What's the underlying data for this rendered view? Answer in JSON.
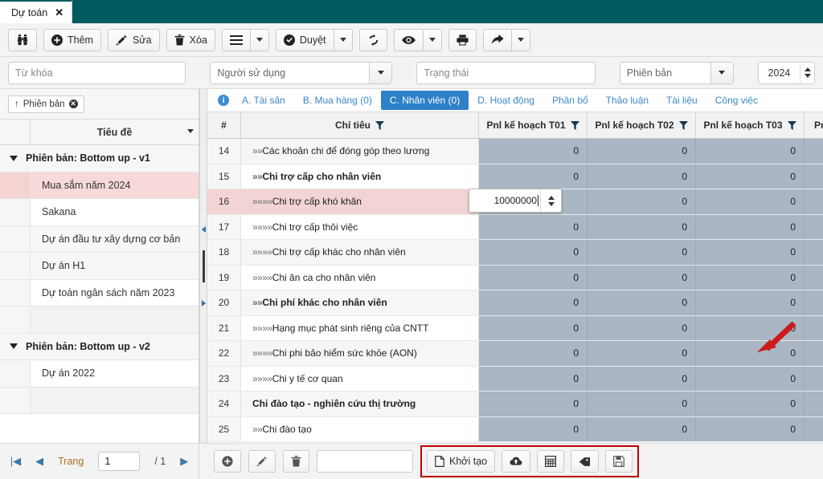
{
  "window": {
    "tab_title": "Dự toán",
    "close_label": "✕"
  },
  "toolbar": {
    "search_icon": "binoculars-icon",
    "add_label": "Thêm",
    "edit_label": "Sửa",
    "delete_label": "Xóa",
    "menu_icon": "hamburger-icon",
    "approve_label": "Duyệt",
    "refresh_icon": "refresh-icon",
    "view_icon": "eye-icon",
    "print_icon": "printer-icon",
    "share_icon": "share-arrow-icon"
  },
  "filters": {
    "keyword_placeholder": "Từ khóa",
    "user_placeholder": "Người sử dụng",
    "status_placeholder": "Trạng thái",
    "version_placeholder": "Phiên bản",
    "year_value": "2024"
  },
  "left_panel": {
    "group_chip": "Phiên bản",
    "group_chip_arrow": "↑",
    "column_header": "Tiêu đề",
    "rows": [
      {
        "type": "group",
        "label": "Phiên bản: Bottom up - v1"
      },
      {
        "type": "item",
        "label": "Mua sắm năm 2024",
        "selected": true
      },
      {
        "type": "item",
        "label": "Sakana",
        "selected": false
      },
      {
        "type": "item",
        "label": "Dự án đầu tư xây dựng cơ bản",
        "selected": false
      },
      {
        "type": "item",
        "label": "Dự án H1",
        "selected": false
      },
      {
        "type": "item",
        "label": "Dự toán ngân sách năm 2023",
        "selected": false
      },
      {
        "type": "blank",
        "label": ""
      },
      {
        "type": "group",
        "label": "Phiên bản: Bottom up - v2"
      },
      {
        "type": "item",
        "label": "Dự án 2022",
        "selected": false
      },
      {
        "type": "blank",
        "label": ""
      }
    ]
  },
  "sub_tabs": {
    "info_icon": "info-icon",
    "items": [
      {
        "label": "A. Tài sản",
        "active": false
      },
      {
        "label": "B. Mua hàng (0)",
        "active": false
      },
      {
        "label": "C. Nhân viên (0)",
        "active": true
      },
      {
        "label": "D. Hoạt động",
        "active": false
      },
      {
        "label": "Phân bổ",
        "active": false
      },
      {
        "label": "Thảo luận",
        "active": false
      },
      {
        "label": "Tài liệu",
        "active": false
      },
      {
        "label": "Công việc",
        "active": false
      }
    ]
  },
  "grid": {
    "columns": [
      {
        "key": "num",
        "label": "#",
        "filter": false
      },
      {
        "key": "name",
        "label": "Chỉ tiêu",
        "filter": true
      },
      {
        "key": "t01",
        "label": "Pnl kế hoạch T01",
        "filter": true
      },
      {
        "key": "t02",
        "label": "Pnl kế hoạch T02",
        "filter": true
      },
      {
        "key": "t03",
        "label": "Pnl kế hoạch T03",
        "filter": true
      },
      {
        "key": "t04",
        "label": "Pnl kế",
        "filter": false
      }
    ],
    "rows": [
      {
        "num": "14",
        "prefix": "»»",
        "name": "Các khoản chi để đóng góp theo lương",
        "bold": false,
        "selected": false,
        "t01": "0",
        "t02": "0",
        "t03": "0"
      },
      {
        "num": "15",
        "prefix": "»»",
        "name": "Chi trợ cấp cho nhân viên",
        "bold": true,
        "selected": false,
        "t01": "0",
        "t02": "0",
        "t03": "0"
      },
      {
        "num": "16",
        "prefix": "»»»»",
        "name": "Chi trợ cấp khó khăn",
        "bold": false,
        "selected": true,
        "t01": "",
        "t02": "0",
        "t03": "0"
      },
      {
        "num": "17",
        "prefix": "»»»»",
        "name": "Chi trợ cấp thôi việc",
        "bold": false,
        "selected": false,
        "t01": "0",
        "t02": "0",
        "t03": "0"
      },
      {
        "num": "18",
        "prefix": "»»»»",
        "name": "Chi trợ cấp khác cho nhân viên",
        "bold": false,
        "selected": false,
        "t01": "0",
        "t02": "0",
        "t03": "0"
      },
      {
        "num": "19",
        "prefix": "»»»»",
        "name": "Chi ăn ca cho nhân viên",
        "bold": false,
        "selected": false,
        "t01": "0",
        "t02": "0",
        "t03": "0"
      },
      {
        "num": "20",
        "prefix": "»»",
        "name": "Chi phí khác cho nhân viên",
        "bold": true,
        "selected": false,
        "t01": "0",
        "t02": "0",
        "t03": "0"
      },
      {
        "num": "21",
        "prefix": "»»»»",
        "name": "Hạng mục phát sinh riêng của CNTT",
        "bold": false,
        "selected": false,
        "t01": "0",
        "t02": "0",
        "t03": "0"
      },
      {
        "num": "22",
        "prefix": "»»»»",
        "name": "Chi phi bảo hiểm sức khỏe (AON)",
        "bold": false,
        "selected": false,
        "t01": "0",
        "t02": "0",
        "t03": "0"
      },
      {
        "num": "23",
        "prefix": "»»»»",
        "name": "Chi y tế cơ quan",
        "bold": false,
        "selected": false,
        "t01": "0",
        "t02": "0",
        "t03": "0"
      },
      {
        "num": "24",
        "prefix": "",
        "name": "Chi đào tạo - nghiên cứu thị trường",
        "bold": true,
        "selected": false,
        "t01": "0",
        "t02": "0",
        "t03": "0"
      },
      {
        "num": "25",
        "prefix": "»»",
        "name": "Chi đào tạo",
        "bold": false,
        "selected": false,
        "t01": "0",
        "t02": "0",
        "t03": "0"
      }
    ],
    "cell_editor": {
      "value": "10000000",
      "spinner_icon": "spinner-up-down-icon"
    },
    "annotation": {
      "arrow_icon": "red-arrow-icon",
      "color": "#cc1a1a"
    }
  },
  "pager": {
    "first_icon": "first-page-icon",
    "prev_icon": "prev-page-icon",
    "page_label": "Trang",
    "page_value": "1",
    "total_label": "/ 1",
    "next_icon": "next-page-icon"
  },
  "bottom_tools": {
    "add_icon": "add-circle-icon",
    "edit_icon": "pencil-icon",
    "delete_icon": "trash-icon",
    "text_value": "",
    "create_label": "Khởi tạo",
    "create_icon": "file-icon",
    "upload_icon": "cloud-upload-icon",
    "table_icon": "grid-table-icon",
    "tag_icon": "tag-icon",
    "save_icon": "floppy-save-icon",
    "highlight_color": "#c00000"
  },
  "colors": {
    "title_bar": "#005a5f",
    "active_tab": "#2e80c8",
    "data_cell": "#aab6c4",
    "selected_row": "#f3d4d4",
    "annotation": "#c00000"
  }
}
